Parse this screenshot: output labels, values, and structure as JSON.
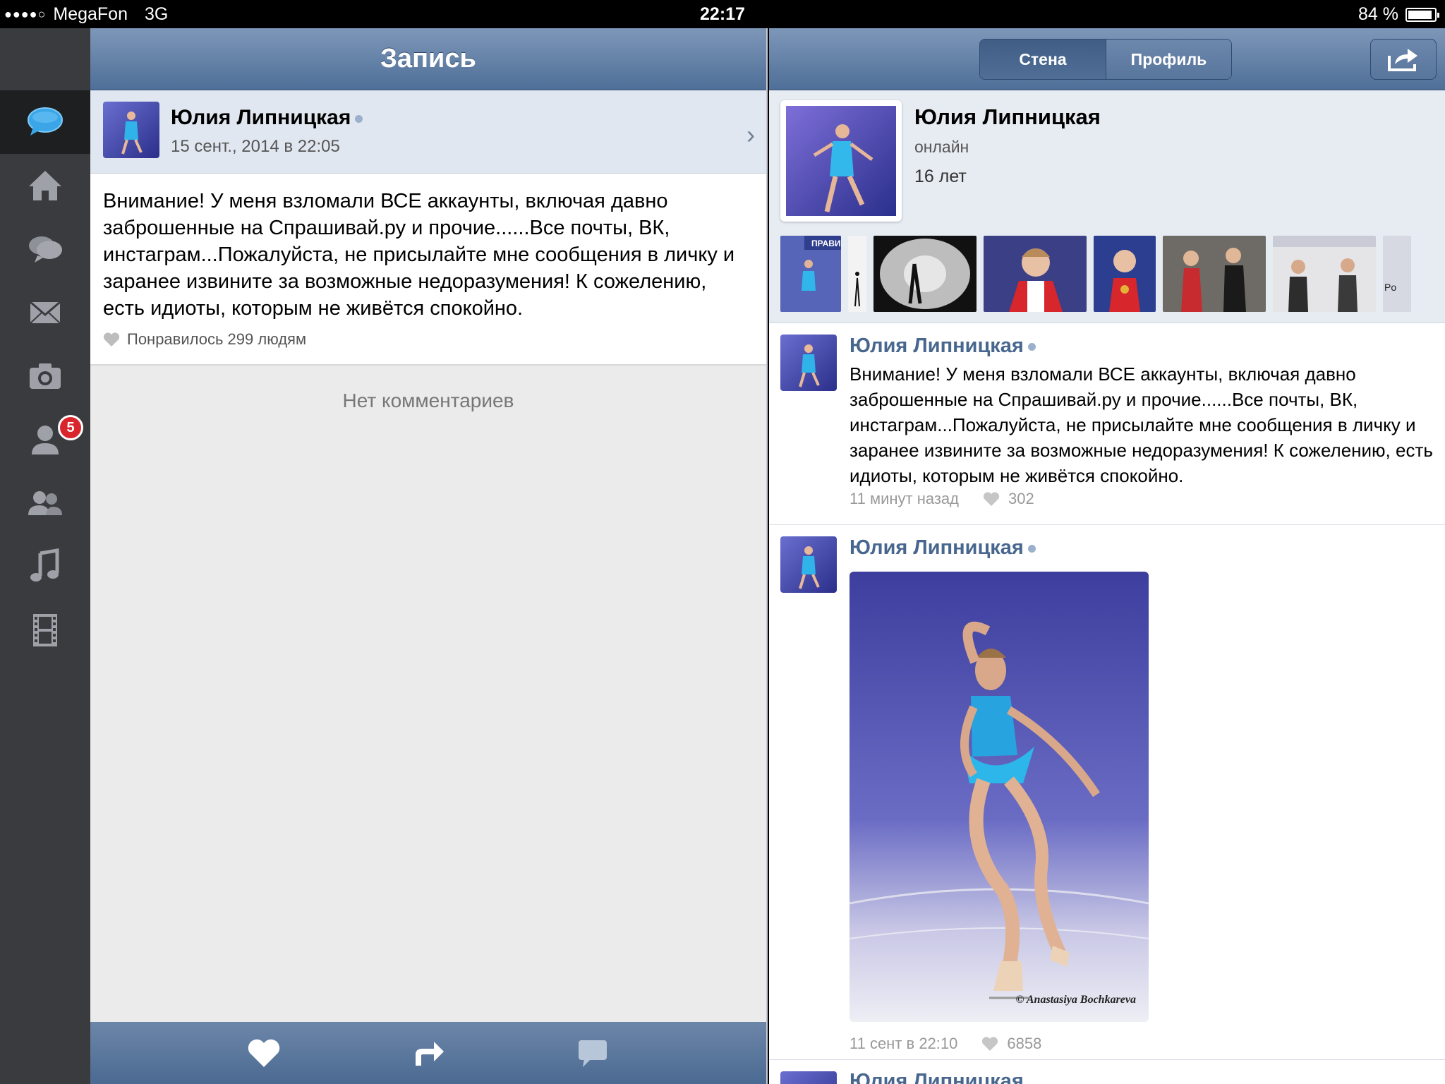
{
  "status": {
    "carrier": "MegaFon",
    "network": "3G",
    "time": "22:17",
    "battery": "84 %"
  },
  "sidebar": {
    "badge": "5"
  },
  "left": {
    "title": "Запись",
    "author": "Юлия Липницкая",
    "date": "15 сент., 2014 в 22:05",
    "post_text": "Внимание! У меня взломали ВСЕ аккаунты, включая давно заброшенные на Спрашивай.ру и прочие......Все почты, ВК, инстаграм...Пожалуйста, не присылайте мне сообщения в личку и заранее извините за возможные недоразумения! К сожелению, есть идиоты, которым не живётся спокойно.",
    "likes": "Понравилось 299 людям",
    "no_comments": "Нет комментариев"
  },
  "right": {
    "tabs": {
      "wall": "Стена",
      "profile": "Профиль"
    },
    "profile": {
      "name": "Юлия Липницкая",
      "status": "онлайн",
      "age": "16 лет"
    },
    "photo_strip_text": {
      "banner": "ПРАВИ",
      "partial": "Po"
    },
    "feed": [
      {
        "author": "Юлия Липницкая",
        "text": "Внимание! У меня взломали ВСЕ аккаунты, включая давно заброшенные на Спрашивай.ру и прочие......Все почты, ВК, инстаграм...Пожалуйста, не присылайте мне сообщения в личку и заранее извините за возможные недоразумения! К сожелению, есть идиоты, которым не живётся спокойно.",
        "time": "11 минут назад",
        "likes": "302"
      },
      {
        "author": "Юлия Липницкая",
        "photo_credit": "© Anastasiya Bochkareva",
        "time": "11 сент в 22:10",
        "likes": "6858"
      },
      {
        "author": "Юлия Липницкая"
      }
    ]
  },
  "colors": {
    "nav_blue": "#5a7aa3",
    "link_blue": "#48678e",
    "badge_red": "#d9262c"
  }
}
